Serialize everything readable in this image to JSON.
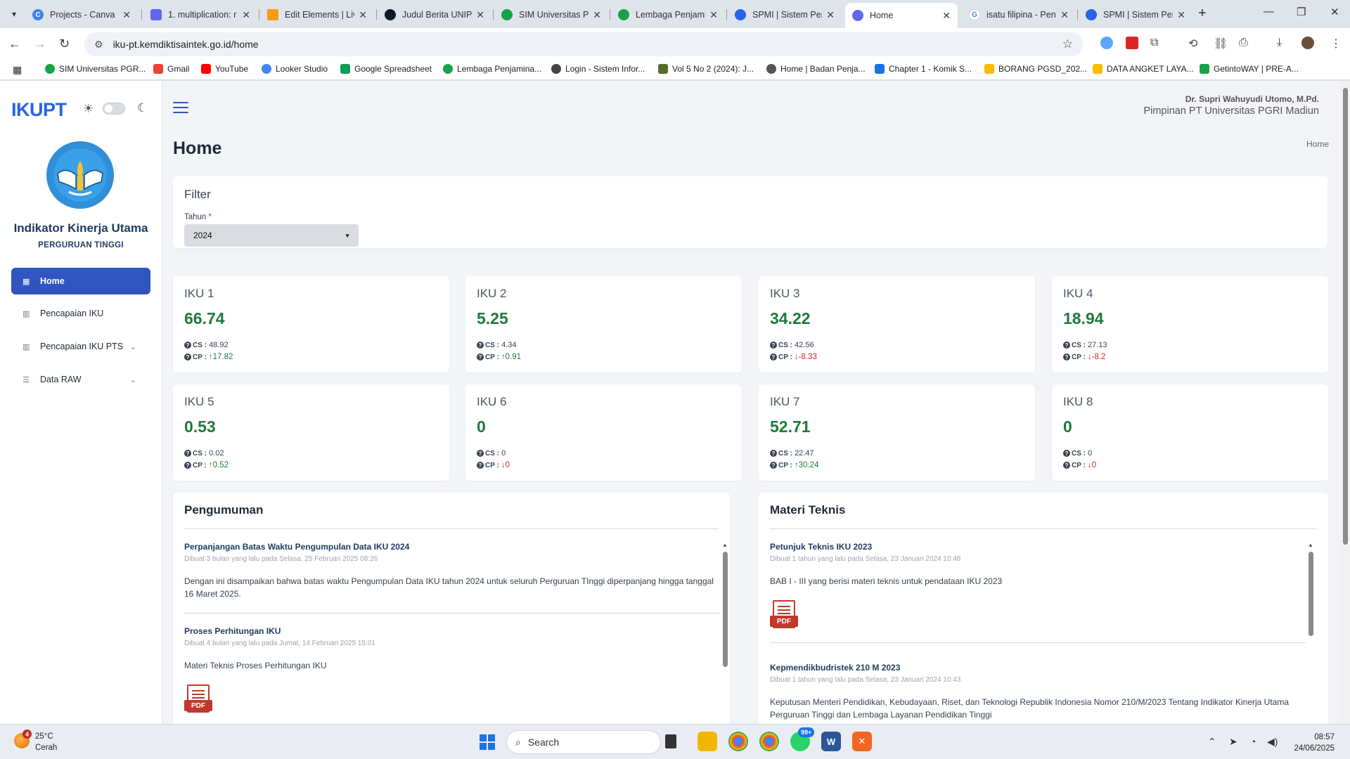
{
  "browser": {
    "tabs": [
      {
        "title": "Projects - Canva",
        "color": "#3b82f6"
      },
      {
        "title": "1. multiplication: r",
        "color": "#6366f1"
      },
      {
        "title": "Edit Elements | Liv",
        "color": "#f59e0b"
      },
      {
        "title": "Judul Berita UNIPG",
        "color": "#111827"
      },
      {
        "title": "SIM Universitas PG",
        "color": "#16a34a"
      },
      {
        "title": "Lembaga Penjamin",
        "color": "#16a34a"
      },
      {
        "title": "SPMI | Sistem Pen",
        "color": "#2563eb"
      },
      {
        "title": "Home",
        "color": "#6366f1"
      },
      {
        "title": "isatu filipina - Pen",
        "color": "#ea4335"
      },
      {
        "title": "SPMI | Sistem Pen",
        "color": "#2563eb"
      }
    ],
    "url": "iku-pt.kemdiktisaintek.go.id/home",
    "bookmarks": [
      {
        "label": "SIM Universitas PGR...",
        "color": "#16a34a"
      },
      {
        "label": "Gmail",
        "color": "#ea4335"
      },
      {
        "label": "YouTube",
        "color": "#ff0000"
      },
      {
        "label": "Looker Studio",
        "color": "#4285f4"
      },
      {
        "label": "Google Spreadsheet",
        "color": "#0f9d58"
      },
      {
        "label": "Lembaga Penjamina...",
        "color": "#16a34a"
      },
      {
        "label": "Login - Sistem Infor...",
        "color": "#444444"
      },
      {
        "label": "Vol 5 No 2 (2024): J...",
        "color": "#556b2f"
      },
      {
        "label": "Home | Badan Penja...",
        "color": "#555555"
      },
      {
        "label": "Chapter 1 - Komik S...",
        "color": "#1a73e8"
      },
      {
        "label": "BORANG PGSD_202...",
        "color": "#fbbc04"
      },
      {
        "label": "DATA ANGKET LAYA...",
        "color": "#fbbc04"
      },
      {
        "label": "GetintoWAY | PRE-A...",
        "color": "#16a34a"
      }
    ]
  },
  "sidebar": {
    "brand": "IKUPT",
    "title": "Indikator Kinerja Utama",
    "subtitle": "PERGURUAN TINGGI",
    "menu": [
      {
        "label": "Home",
        "icon": "grid-icon"
      },
      {
        "label": "Pencapaian IKU",
        "icon": "bar-chart-icon"
      },
      {
        "label": "Pencapaian IKU PTS",
        "icon": "bar-chart-icon"
      },
      {
        "label": "Data RAW",
        "icon": "database-icon"
      }
    ]
  },
  "header": {
    "user_name": "Dr. Supri Wahuyudi Utomo, M.Pd.",
    "user_role": "Pimpinan PT Universitas PGRI Madiun",
    "page_title": "Home",
    "breadcrumb": "Home"
  },
  "filter": {
    "title": "Filter",
    "year_label": "Tahun",
    "required_mark": "*",
    "year_value": "2024"
  },
  "iku_cards": [
    {
      "name": "IKU 1",
      "value": "66.74",
      "cs": "48.92",
      "cp": "17.82",
      "trend": "up"
    },
    {
      "name": "IKU 2",
      "value": "5.25",
      "cs": "4.34",
      "cp": "0.91",
      "trend": "up"
    },
    {
      "name": "IKU 3",
      "value": "34.22",
      "cs": "42.56",
      "cp": "-8.33",
      "trend": "down"
    },
    {
      "name": "IKU 4",
      "value": "18.94",
      "cs": "27.13",
      "cp": "-8.2",
      "trend": "down"
    },
    {
      "name": "IKU 5",
      "value": "0.53",
      "cs": "0.02",
      "cp": "0.52",
      "trend": "up"
    },
    {
      "name": "IKU 6",
      "value": "0",
      "cs": "0",
      "cp": "0",
      "trend": "down"
    },
    {
      "name": "IKU 7",
      "value": "52.71",
      "cs": "22.47",
      "cp": "30.24",
      "trend": "up"
    },
    {
      "name": "IKU 8",
      "value": "0",
      "cs": "0",
      "cp": "0",
      "trend": "down"
    }
  ],
  "labels": {
    "cs": "CS :",
    "cp": "CP :",
    "pdf": "PDF"
  },
  "pengumuman": {
    "title": "Pengumuman",
    "items": [
      {
        "title": "Perpanjangan Batas Waktu Pengumpulan Data IKU 2024",
        "meta": "Dibuat 3 bulan yang lalu pada Selasa, 25 Februari 2025 08:26",
        "body": "Dengan ini disampaikan bahwa batas waktu Pengumpulan Data IKU tahun 2024 untuk seluruh Perguruan TInggi diperpanjang hingga tanggal 16 Maret 2025."
      },
      {
        "title": "Proses Perhitungan IKU",
        "meta": "Dibuat 4 bulan yang lalu pada Jumat, 14 Februari 2025 15:01",
        "body": "Materi Teknis Proses Perhitungan IKU"
      }
    ]
  },
  "materi": {
    "title": "Materi Teknis",
    "items": [
      {
        "title": "Petunjuk Teknis IKU 2023",
        "meta": "Dibuat 1 tahun yang lalu pada Selasa, 23 Januari 2024 10:48",
        "body": "BAB I - III yang berisi materi teknis untuk pendataan IKU 2023"
      },
      {
        "title": "Kepmendikbudristek 210 M 2023",
        "meta": "Dibuat 1 tahun yang lalu pada Selasa, 23 Januari 2024 10:43",
        "body": "Keputusan Menteri Pendidikan, Kebudayaan, Riset, dan Teknologi Republik Indonesia Nomor 210/M/2023 Tentang Indikator Kinerja Utama Perguruan Tinggi dan Lembaga Layanan Pendidikan Tinggi"
      }
    ]
  },
  "taskbar": {
    "temperature": "25°C",
    "weather": "Cerah",
    "weather_badge": "4",
    "search_placeholder": "Search",
    "whatsapp_badge": "99+",
    "time": "08:57",
    "date": "24/06/2025"
  },
  "colors": {
    "accent": "#2f56c0",
    "positive": "#1e7b3a",
    "negative": "#dc2626"
  }
}
